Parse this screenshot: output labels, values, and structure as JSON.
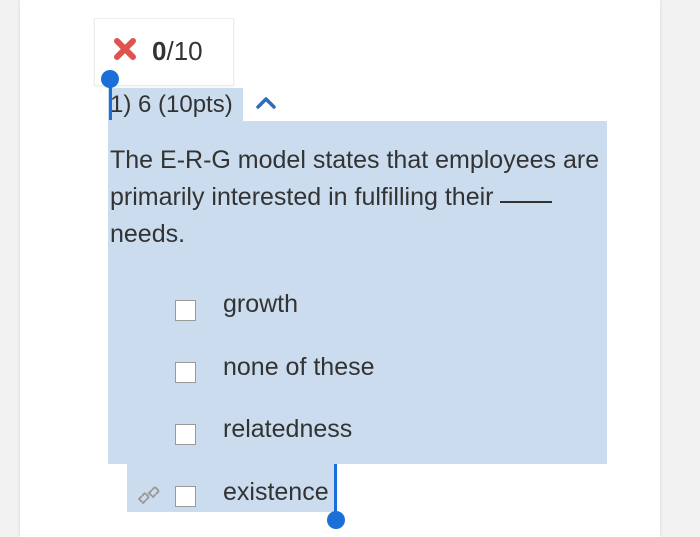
{
  "score": {
    "earned": "0",
    "total": "/10",
    "status_icon": "red-x-icon"
  },
  "question": {
    "header": "1) 6 (10pts)",
    "collapse_icon": "chevron-up-icon",
    "text": "The E-R-G model states that employees are primarily interested in fulfilling their",
    "text_after_blank": "needs.",
    "options": [
      {
        "label": "growth",
        "checked": false
      },
      {
        "label": "none of these",
        "checked": false
      },
      {
        "label": "relatedness",
        "checked": false
      },
      {
        "label": "existence",
        "checked": false
      }
    ],
    "incorrect_marker_icon": "broken-link-icon"
  },
  "colors": {
    "selection": "#cadcee",
    "handle": "#1a6fd8",
    "error": "#e0524d",
    "accent": "#2f6db5",
    "text": "#333333"
  }
}
